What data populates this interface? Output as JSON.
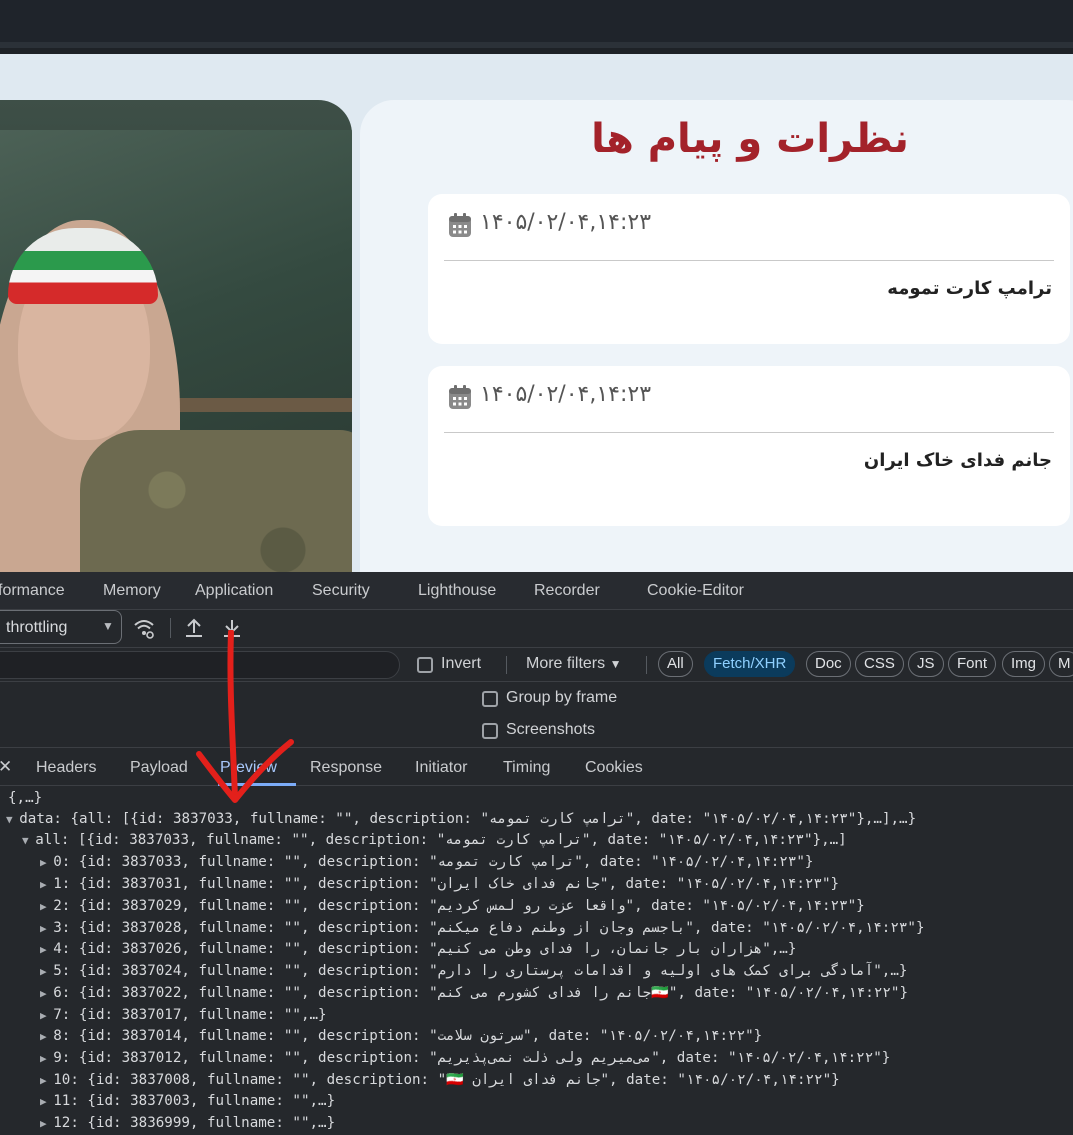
{
  "webpage": {
    "title": "نظرات و پیام ها",
    "messages": [
      {
        "date": "۱۴۰۵/۰۲/۰۴,۱۴:۲۳",
        "text": "ترامپ کارت تمومه"
      },
      {
        "date": "۱۴۰۵/۰۲/۰۴,۱۴:۲۳",
        "text": "جانم فدای خاک ایران"
      }
    ]
  },
  "devtools": {
    "tabs": [
      "formance",
      "Memory",
      "Application",
      "Security",
      "Lighthouse",
      "Recorder",
      "Cookie-Editor"
    ],
    "throttling": "throttling",
    "filters": {
      "invert": "Invert",
      "more_filters": "More filters",
      "chips": [
        "All",
        "Fetch/XHR",
        "Doc",
        "CSS",
        "JS",
        "Font",
        "Img",
        "M"
      ]
    },
    "options": {
      "group_by_frame": "Group by frame",
      "screenshots": "Screenshots"
    },
    "detail_tabs": [
      "Headers",
      "Payload",
      "Preview",
      "Response",
      "Initiator",
      "Timing",
      "Cookies"
    ],
    "preview_lines": [
      "{,…}",
      "data: {all: [{id: 3837033, fullname: \"\", description: \"ترامپ کارت تمومه\", date: \"۱۴۰۵/۰۲/۰۴,۱۴:۲۳\"},…],…}",
      "all: [{id: 3837033, fullname: \"\", description: \"ترامپ کارت تمومه\", date: \"۱۴۰۵/۰۲/۰۴,۱۴:۲۳\"},…]",
      "0: {id: 3837033, fullname: \"\", description: \"ترامپ کارت تمومه\", date: \"۱۴۰۵/۰۲/۰۴,۱۴:۲۳\"}",
      "1: {id: 3837031, fullname: \"\", description: \"جانم فدای خاک ایران\", date: \"۱۴۰۵/۰۲/۰۴,۱۴:۲۳\"}",
      "2: {id: 3837029, fullname: \"\", description: \"واقعا عزت رو لمس کردیم\", date: \"۱۴۰۵/۰۲/۰۴,۱۴:۲۳\"}",
      "3: {id: 3837028, fullname: \"\", description: \"باجسم وجان از وطنم دفاع میکنم\", date: \"۱۴۰۵/۰۲/۰۴,۱۴:۲۳\"}",
      "4: {id: 3837026, fullname: \"\", description: \"هزاران بار جانمان، را فدای وطن می کنیم\",…}",
      "5: {id: 3837024, fullname: \"\", description: \"آمادگی برای کمک های اولیه و اقدامات پرستاری را دارم\",…}",
      "6: {id: 3837022, fullname: \"\", description: \"جانم را فدای کشورم می کنم🇮🇷\", date: \"۱۴۰۵/۰۲/۰۴,۱۴:۲۲\"}",
      "7: {id: 3837017, fullname: \"\",…}",
      "8: {id: 3837014, fullname: \"\", description: \"سرتون سلامت\", date: \"۱۴۰۵/۰۲/۰۴,۱۴:۲۲\"}",
      "9: {id: 3837012, fullname: \"\", description: \"می‌میریم ولی ذلت نمی‌پذیریم\", date: \"۱۴۰۵/۰۲/۰۴,۱۴:۲۲\"}",
      "10: {id: 3837008, fullname: \"\", description: \"🇮🇷 جانم فدای ایران\", date: \"۱۴۰۵/۰۲/۰۴,۱۴:۲۲\"}",
      "11: {id: 3837003, fullname: \"\",…}",
      "12: {id: 3836999, fullname: \"\",…}"
    ]
  },
  "colors": {
    "title_red": "#a3222a",
    "annotation_red": "#e3201b",
    "active_chip": "#0b3b5c"
  },
  "icons": [
    "calendar-icon",
    "wifi-settings-icon",
    "upload-icon",
    "download-icon",
    "dropdown-caret-icon",
    "close-icon"
  ]
}
